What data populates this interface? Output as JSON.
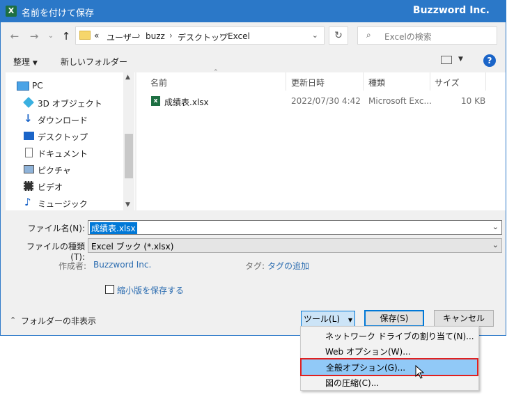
{
  "window": {
    "title": "名前を付けて保存",
    "brand": "Buzzword Inc."
  },
  "address": {
    "prefix": "«",
    "crumbs": [
      "ユーザー",
      "buzz",
      "デスクトップ",
      "Excel"
    ]
  },
  "search": {
    "placeholder": "Excelの検索"
  },
  "toolbar": {
    "organize": "整理",
    "new_folder": "新しいフォルダー"
  },
  "nav": {
    "items": [
      {
        "label": "PC",
        "icon": "pc-icon"
      },
      {
        "label": "3D オブジェクト",
        "icon": "3d-objects-icon"
      },
      {
        "label": "ダウンロード",
        "icon": "download-icon"
      },
      {
        "label": "デスクトップ",
        "icon": "desktop-icon"
      },
      {
        "label": "ドキュメント",
        "icon": "document-icon"
      },
      {
        "label": "ピクチャ",
        "icon": "picture-icon"
      },
      {
        "label": "ビデオ",
        "icon": "video-icon"
      },
      {
        "label": "ミュージック",
        "icon": "music-icon"
      }
    ]
  },
  "files": {
    "columns": {
      "name": "名前",
      "modified": "更新日時",
      "type": "種類",
      "size": "サイズ"
    },
    "rows": [
      {
        "name": "成績表.xlsx",
        "modified": "2022/07/30 4:42",
        "type": "Microsoft Exc...",
        "size": "10 KB"
      }
    ]
  },
  "form": {
    "filename_label": "ファイル名(N):",
    "filename_value": "成績表.xlsx",
    "filetype_label": "ファイルの種類(T):",
    "filetype_value": "Excel ブック (*.xlsx)",
    "author_label": "作成者:",
    "author_value": "Buzzword Inc.",
    "tags_label": "タグ:",
    "tags_value": "タグの追加",
    "thumbnail_label": "縮小版を保存する"
  },
  "footer": {
    "hide_folders": "フォルダーの非表示",
    "tools": "ツール(L)",
    "save": "保存(S)",
    "cancel": "キャンセル"
  },
  "tools_menu": {
    "items": [
      {
        "label": "ネットワーク ドライブの割り当て(N)..."
      },
      {
        "label": "Web オプション(W)..."
      },
      {
        "label": "全般オプション(G)...",
        "highlighted": true
      },
      {
        "label": "図の圧縮(C)..."
      }
    ]
  },
  "colors": {
    "accent": "#2b78c8",
    "highlight": "#91c9f7",
    "highlight_border": "#e02020"
  }
}
